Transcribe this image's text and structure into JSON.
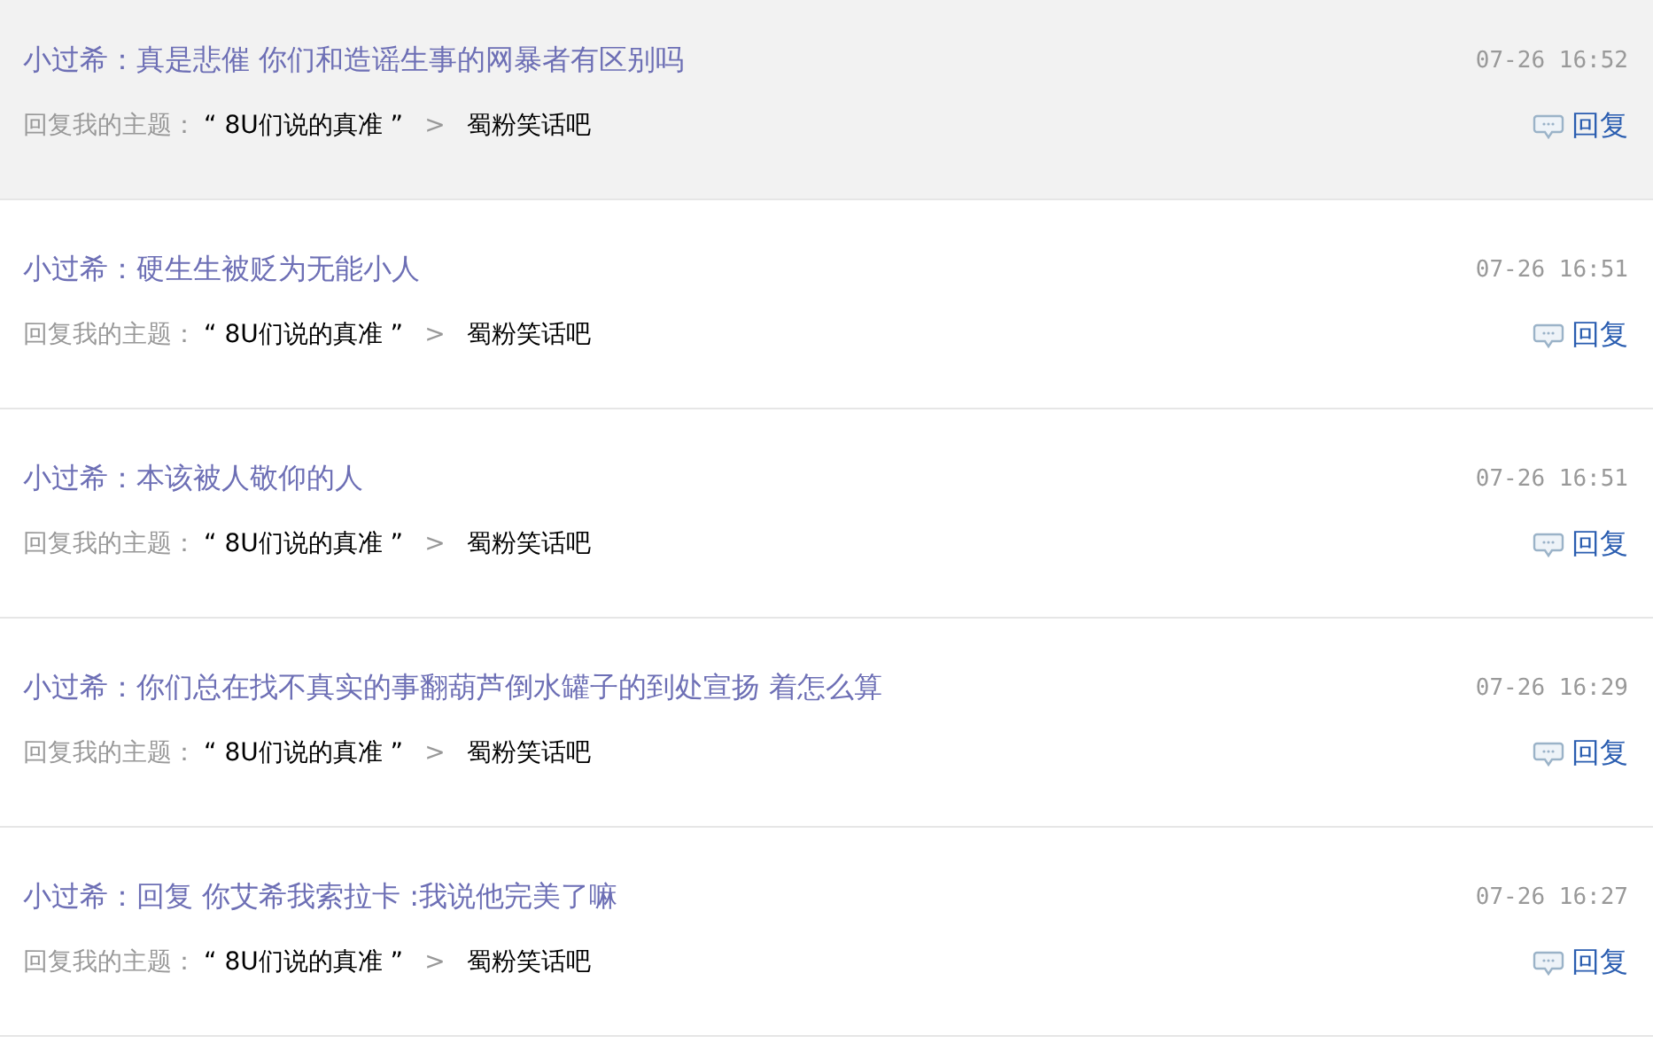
{
  "items": [
    {
      "selected": true,
      "message": "小过希：真是悲催 你们和造谣生事的网暴者有区别吗",
      "time": "07-26 16:52",
      "label": "回复我的主题：",
      "topic": "“ 8U们说的真准 ”",
      "separator": ">",
      "forum": "蜀粉笑话吧",
      "reply": "回复"
    },
    {
      "selected": false,
      "message": "小过希：硬生生被贬为无能小人",
      "time": "07-26 16:51",
      "label": "回复我的主题：",
      "topic": "“ 8U们说的真准 ”",
      "separator": ">",
      "forum": "蜀粉笑话吧",
      "reply": "回复"
    },
    {
      "selected": false,
      "message": "小过希：本该被人敬仰的人",
      "time": "07-26 16:51",
      "label": "回复我的主题：",
      "topic": "“ 8U们说的真准 ”",
      "separator": ">",
      "forum": "蜀粉笑话吧",
      "reply": "回复"
    },
    {
      "selected": false,
      "message": "小过希：你们总在找不真实的事翻葫芦倒水罐子的到处宣扬 着怎么算",
      "time": "07-26 16:29",
      "label": "回复我的主题：",
      "topic": "“ 8U们说的真准 ”",
      "separator": ">",
      "forum": "蜀粉笑话吧",
      "reply": "回复"
    },
    {
      "selected": false,
      "message": "小过希：回复 你艾希我索拉卡 :我说他完美了嘛",
      "time": "07-26 16:27",
      "label": "回复我的主题：",
      "topic": "“ 8U们说的真准 ”",
      "separator": ">",
      "forum": "蜀粉笑话吧",
      "reply": "回复"
    }
  ]
}
